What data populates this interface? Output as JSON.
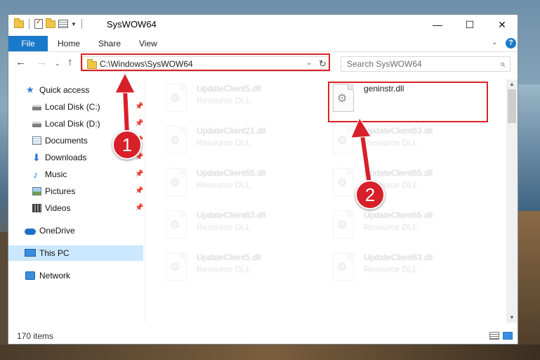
{
  "window": {
    "title": "SysWOW64",
    "minimize_glyph": "—",
    "maximize_glyph": "☐",
    "close_glyph": "✕"
  },
  "ribbon": {
    "tabs": [
      "File",
      "Home",
      "Share",
      "View"
    ],
    "help_glyph": "?",
    "expand_glyph": "⌄"
  },
  "navigation": {
    "address_path": "C:\\Windows\\SysWOW64",
    "search_placeholder": "Search SysWOW64"
  },
  "sidebar": {
    "items": [
      {
        "label": "Quick access",
        "icon": "star-icon",
        "pinned": false
      },
      {
        "label": "Local Disk (C:)",
        "icon": "drive-icon",
        "pinned": true
      },
      {
        "label": "Local Disk (D:)",
        "icon": "drive-icon",
        "pinned": true
      },
      {
        "label": "Documents",
        "icon": "documents-icon",
        "pinned": true
      },
      {
        "label": "Downloads",
        "icon": "download-icon",
        "pinned": true
      },
      {
        "label": "Music",
        "icon": "music-icon",
        "pinned": true
      },
      {
        "label": "Pictures",
        "icon": "pictures-icon",
        "pinned": true
      },
      {
        "label": "Videos",
        "icon": "videos-icon",
        "pinned": true
      },
      {
        "label": "OneDrive",
        "icon": "cloud-icon",
        "pinned": false
      },
      {
        "label": "This PC",
        "icon": "computer-icon",
        "pinned": false,
        "selected": true
      },
      {
        "label": "Network",
        "icon": "network-icon",
        "pinned": false
      }
    ]
  },
  "files": {
    "left_column": [
      {
        "name": "UpdateClient5.dll",
        "type": "Resource DLL"
      },
      {
        "name": "UpdateClient21.dll",
        "type": "Resource DLL"
      },
      {
        "name": "UpdateClient65.dll",
        "type": "Resource DLL"
      },
      {
        "name": "UpdateClient63.dll",
        "type": "Resource DLL"
      },
      {
        "name": "UpdateClient5.dll",
        "type": "Resource DLL"
      }
    ],
    "right_column": [
      {
        "name": "geninstr.dll",
        "type": "",
        "highlighted": true
      },
      {
        "name": "UpdateClient63.dll",
        "type": "Resource DLL"
      },
      {
        "name": "UpdateClient65.dll",
        "type": "Resource DLL"
      },
      {
        "name": "UpdateClient65.dll",
        "type": "Resource DLL"
      },
      {
        "name": "UpdateClient63.dll",
        "type": "Resource DLL"
      }
    ]
  },
  "status": {
    "item_count": "170 items"
  },
  "callouts": {
    "step1": "1",
    "step2": "2"
  },
  "colors": {
    "accent": "#1979ca",
    "highlight_border": "#dd2222",
    "badge": "#d8202a",
    "selection": "#cce8ff"
  }
}
